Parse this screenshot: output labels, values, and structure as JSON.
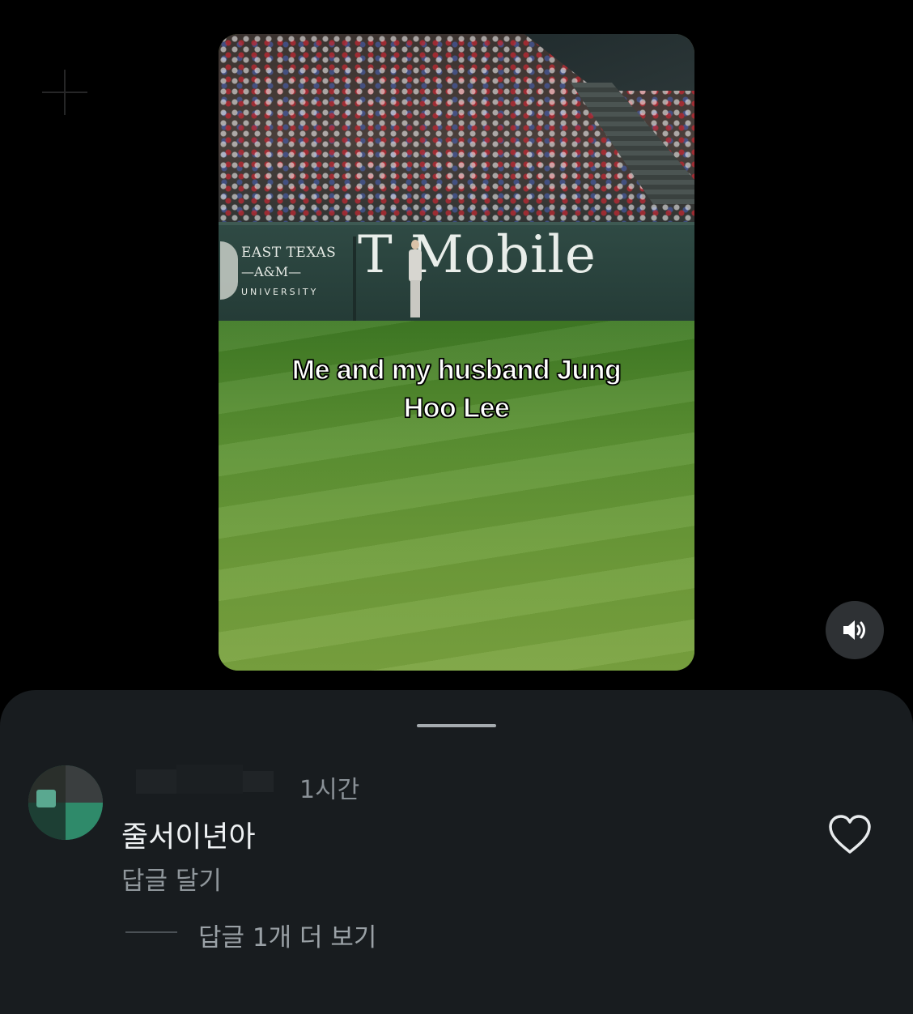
{
  "video": {
    "caption_line1": "Me and my husband Jung",
    "caption_line2": "Hoo Lee",
    "wall_ad_left": {
      "line1": "EAST TEXAS",
      "line2": "—A&M—",
      "line3": "UNIVERSITY"
    },
    "wall_ad_right": "T Mobile"
  },
  "sound_button": {
    "icon": "speaker-volume-icon"
  },
  "comments": {
    "item": {
      "time": "1시간",
      "text": "줄서이년아",
      "reply_label": "답글 달기",
      "more_replies": "답글 1개 더 보기",
      "like_icon": "heart-outline-icon"
    }
  },
  "colors": {
    "background": "#000000",
    "sheet": "#181c1f",
    "secondary_text": "#8f969b"
  }
}
